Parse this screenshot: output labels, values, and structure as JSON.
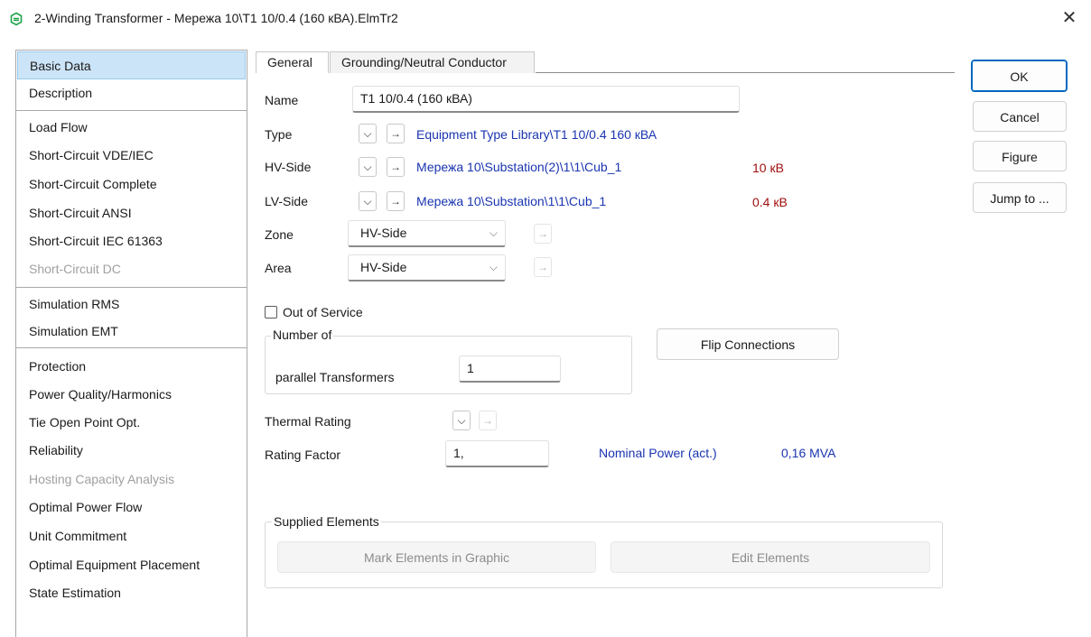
{
  "window": {
    "title": "2-Winding Transformer - Мережа 10\\Т1 10/0.4 (160 кВА).ElmTr2",
    "close": "✕"
  },
  "nav": {
    "items": [
      {
        "label": "Basic Data",
        "state": "selected"
      },
      {
        "label": "Description",
        "state": "normal"
      },
      {
        "label": "Load Flow",
        "state": "normal"
      },
      {
        "label": "Short-Circuit VDE/IEC",
        "state": "normal"
      },
      {
        "label": "Short-Circuit Complete",
        "state": "normal"
      },
      {
        "label": "Short-Circuit ANSI",
        "state": "normal"
      },
      {
        "label": "Short-Circuit IEC 61363",
        "state": "normal"
      },
      {
        "label": "Short-Circuit DC",
        "state": "disabled"
      },
      {
        "label": "Simulation RMS",
        "state": "normal"
      },
      {
        "label": "Simulation EMT",
        "state": "normal"
      },
      {
        "label": "Protection",
        "state": "normal"
      },
      {
        "label": "Power Quality/Harmonics",
        "state": "normal"
      },
      {
        "label": "Tie Open Point Opt.",
        "state": "normal"
      },
      {
        "label": "Reliability",
        "state": "normal"
      },
      {
        "label": "Hosting Capacity Analysis",
        "state": "disabled"
      },
      {
        "label": "Optimal Power Flow",
        "state": "normal"
      },
      {
        "label": "Unit Commitment",
        "state": "normal"
      },
      {
        "label": "Optimal Equipment Placement",
        "state": "normal"
      },
      {
        "label": "State Estimation",
        "state": "normal"
      }
    ]
  },
  "tabs": [
    {
      "label": "General",
      "active": true
    },
    {
      "label": "Grounding/Neutral Conductor",
      "active": false
    }
  ],
  "buttons": {
    "ok": "OK",
    "cancel": "Cancel",
    "figure": "Figure",
    "jump": "Jump to ..."
  },
  "form": {
    "name_label": "Name",
    "name_value": "Т1 10/0.4 (160 кВА)",
    "type_label": "Type",
    "type_link": "Equipment Type Library\\Т1 10/0.4 160 кВА",
    "hv_label": "HV-Side",
    "hv_link": "Мережа 10\\Substation(2)\\1\\1\\Cub_1",
    "hv_voltage": "10 кВ",
    "lv_label": "LV-Side",
    "lv_link": "Мережа 10\\Substation\\1\\1\\Cub_1",
    "lv_voltage": "0.4 кВ",
    "zone_label": "Zone",
    "zone_value": "HV-Side",
    "area_label": "Area",
    "area_value": "HV-Side",
    "dropdown_glyph": "⌵",
    "arrow_glyph": "→",
    "out_of_service_label": "Out of Service",
    "out_of_service_checked": false,
    "number_of_title": "Number of",
    "parallel_label": "parallel Transformers",
    "parallel_value": "1",
    "flip_button": "Flip Connections",
    "thermal_label": "Thermal Rating",
    "rating_factor_label": "Rating Factor",
    "rating_factor_value": "1,",
    "nominal_power_label": "Nominal Power (act.)",
    "nominal_power_value": "0,16 MVA",
    "supplied_title": "Supplied Elements",
    "mark_button": "Mark Elements in Graphic",
    "edit_button": "Edit Elements"
  },
  "colors": {
    "link": "#1a35b0",
    "voltage": "#a01010",
    "selected_bg": "#cce4f7",
    "accent": "#0067c0"
  }
}
